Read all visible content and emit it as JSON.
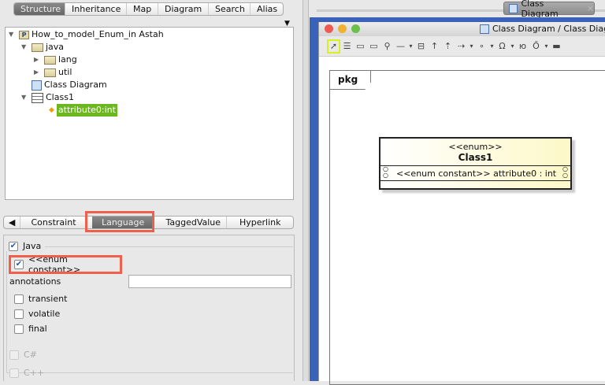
{
  "left": {
    "top_tabs": [
      "Structure",
      "Inheritance",
      "Map",
      "Diagram",
      "Search",
      "Alias"
    ],
    "selected_top_tab": "Structure",
    "tree": {
      "project": "How_to_model_Enum_in Astah",
      "java": "java",
      "lang": "lang",
      "util": "util",
      "diagram": "Class Diagram",
      "class": "Class1",
      "attribute": "attribute0:int"
    },
    "prop_tabs": [
      "Constraint",
      "Language",
      "TaggedValue",
      "Hyperlink"
    ],
    "selected_prop_tab": "Language",
    "java_label": "Java",
    "enum_constant_label": "<<enum constant>>",
    "annotations_label": "annotations",
    "annotations_value": "",
    "checks": [
      "transient",
      "volatile",
      "final"
    ],
    "csharp_label": "C#",
    "cpp_label": "C++"
  },
  "right": {
    "tab_label": "Class Diagram",
    "window_title": "Class Diagram / Class Diagram",
    "frame_label": "pkg",
    "class_stereotype": "<<enum>>",
    "class_name": "Class1",
    "attribute_text": "<<enum constant>> attribute0 : int",
    "accent": "#3a62b8",
    "highlight": "#ef5f4c",
    "selection": "#6bb81e"
  }
}
